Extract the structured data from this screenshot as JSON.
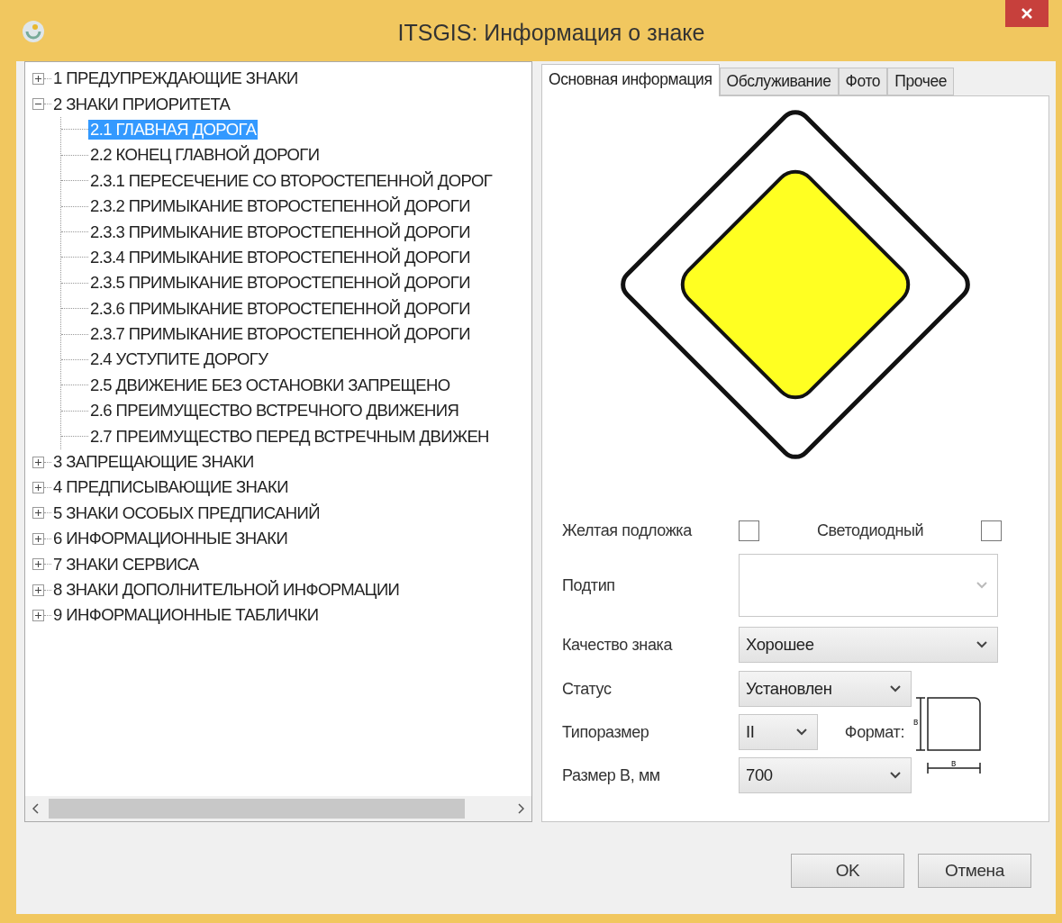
{
  "window": {
    "title": "ITSGIS: Информация о знаке"
  },
  "tree": [
    {
      "label": "1 ПРЕДУПРЕЖДАЮЩИЕ ЗНАКИ",
      "expanded": false,
      "selected": false
    },
    {
      "label": "2 ЗНАКИ ПРИОРИТЕТА",
      "expanded": true,
      "selected": false,
      "children": [
        {
          "label": "2.1 ГЛАВНАЯ ДОРОГА",
          "selected": true
        },
        {
          "label": "2.2 КОНЕЦ ГЛАВНОЙ ДОРОГИ",
          "selected": false
        },
        {
          "label": "2.3.1 ПЕРЕСЕЧЕНИЕ СО ВТОРОСТЕПЕННОЙ ДОРОГ",
          "selected": false
        },
        {
          "label": "2.3.2 ПРИМЫКАНИЕ ВТОРОСТЕПЕННОЙ ДОРОГИ",
          "selected": false
        },
        {
          "label": "2.3.3 ПРИМЫКАНИЕ ВТОРОСТЕПЕННОЙ ДОРОГИ",
          "selected": false
        },
        {
          "label": "2.3.4 ПРИМЫКАНИЕ ВТОРОСТЕПЕННОЙ ДОРОГИ",
          "selected": false
        },
        {
          "label": "2.3.5 ПРИМЫКАНИЕ ВТОРОСТЕПЕННОЙ ДОРОГИ",
          "selected": false
        },
        {
          "label": "2.3.6 ПРИМЫКАНИЕ ВТОРОСТЕПЕННОЙ ДОРОГИ",
          "selected": false
        },
        {
          "label": "2.3.7 ПРИМЫКАНИЕ ВТОРОСТЕПЕННОЙ ДОРОГИ",
          "selected": false
        },
        {
          "label": "2.4 УСТУПИТЕ ДОРОГУ",
          "selected": false
        },
        {
          "label": "2.5 ДВИЖЕНИЕ БЕЗ ОСТАНОВКИ ЗАПРЕЩЕНО",
          "selected": false
        },
        {
          "label": "2.6 ПРЕИМУЩЕСТВО ВСТРЕЧНОГО ДВИЖЕНИЯ",
          "selected": false
        },
        {
          "label": "2.7 ПРЕИМУЩЕСТВО ПЕРЕД ВСТРЕЧНЫМ ДВИЖЕН",
          "selected": false
        }
      ]
    },
    {
      "label": "3 ЗАПРЕЩАЮЩИЕ ЗНАКИ",
      "expanded": false,
      "selected": false
    },
    {
      "label": "4 ПРЕДПИСЫВАЮЩИЕ ЗНАКИ",
      "expanded": false,
      "selected": false
    },
    {
      "label": "5 ЗНАКИ ОСОБЫХ ПРЕДПИСАНИЙ",
      "expanded": false,
      "selected": false
    },
    {
      "label": "6 ИНФОРМАЦИОННЫЕ ЗНАКИ",
      "expanded": false,
      "selected": false
    },
    {
      "label": "7 ЗНАКИ СЕРВИСА",
      "expanded": false,
      "selected": false
    },
    {
      "label": "8 ЗНАКИ ДОПОЛНИТЕЛЬНОЙ ИНФОРМАЦИИ",
      "expanded": false,
      "selected": false
    },
    {
      "label": "9 ИНФОРМАЦИОННЫЕ ТАБЛИЧКИ",
      "expanded": false,
      "selected": false
    }
  ],
  "tabs": [
    {
      "label": "Основная информация",
      "selected": true
    },
    {
      "label": "Обслуживание",
      "selected": false
    },
    {
      "label": "Фото",
      "selected": false
    },
    {
      "label": "Прочее",
      "selected": false
    }
  ],
  "form": {
    "checkboxes": [
      {
        "label": "Желтая подложка",
        "checked": false
      },
      {
        "label": "Светодиодный",
        "checked": false
      }
    ],
    "subtype": {
      "label": "Подтип",
      "disabled": true
    },
    "quality": {
      "label": "Качество знака",
      "value": "Хорошее"
    },
    "status": {
      "label": "Статус",
      "value": "Установлен"
    },
    "size_type": {
      "label": "Типоразмер",
      "value": "II"
    },
    "format": {
      "label": "Формат:",
      "height_label": "в",
      "width_label": "в"
    },
    "size_b": {
      "label": "Размер В, мм",
      "value": "700"
    }
  },
  "buttons": [
    {
      "label": "OK"
    },
    {
      "label": "Отмена"
    }
  ]
}
